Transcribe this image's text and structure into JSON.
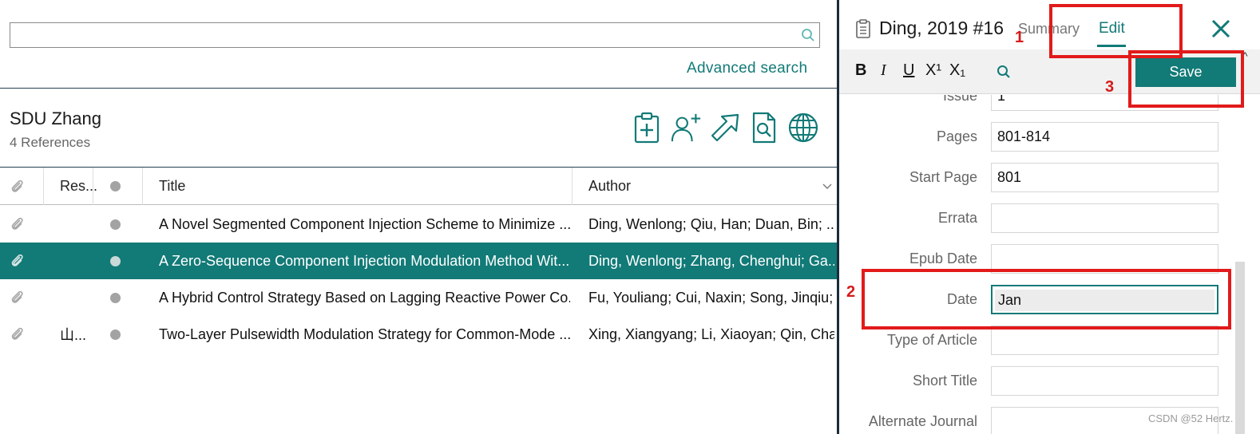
{
  "search": {
    "value": "",
    "placeholder": ""
  },
  "advanced_search_label": "Advanced search",
  "group": {
    "title": "SDU Zhang",
    "count": "4 References"
  },
  "toolbar_icons": [
    "add-reference-icon",
    "add-user-icon",
    "export-arrow-icon",
    "find-pdf-icon",
    "online-search-globe-icon"
  ],
  "table": {
    "headers": {
      "attachment": "",
      "research": "Res...",
      "read": "",
      "title": "Title",
      "author": "Author"
    },
    "rows": [
      {
        "research": "",
        "title": "A Novel Segmented Component Injection Scheme to Minimize ...",
        "author": "Ding, Wenlong; Qiu, Han; Duan, Bin; ...",
        "selected": false
      },
      {
        "research": "",
        "title": "A Zero-Sequence Component Injection Modulation Method Wit...",
        "author": "Ding, Wenlong; Zhang, Chenghui; Ga...",
        "selected": true
      },
      {
        "research": "",
        "title": "A Hybrid Control Strategy Based on Lagging Reactive Power Co...",
        "author": "Fu, Youliang; Cui, Naxin; Song, Jinqiu; ...",
        "selected": false
      },
      {
        "research": "山...",
        "title": "Two-Layer Pulsewidth Modulation Strategy for Common-Mode ...",
        "author": "Xing, Xiangyang; Li, Xiaoyan; Qin, Cha...",
        "selected": false
      }
    ]
  },
  "detail": {
    "ref_title": "Ding, 2019 #16",
    "tab_summary": "Summary",
    "tab_edit": "Edit",
    "format_buttons": {
      "bold": "B",
      "italic": "I",
      "underline": "U",
      "superscript": "X¹",
      "subscript": "X₁"
    },
    "save_label": "Save",
    "fields": [
      {
        "label": "Issue",
        "value": "1"
      },
      {
        "label": "Pages",
        "value": "801-814"
      },
      {
        "label": "Start Page",
        "value": "801"
      },
      {
        "label": "Errata",
        "value": ""
      },
      {
        "label": "Epub Date",
        "value": ""
      },
      {
        "label": "Date",
        "value": "Jan"
      },
      {
        "label": "Type of Article",
        "value": ""
      },
      {
        "label": "Short Title",
        "value": ""
      },
      {
        "label": "Alternate Journal",
        "value": ""
      }
    ]
  },
  "annotations": {
    "n1": "1",
    "n2": "2",
    "n3": "3"
  },
  "watermark": "CSDN @52 Hertz.",
  "colors": {
    "accent": "#127a77",
    "annotation_red": "#e21a1a",
    "dark_bar": "#0d2236"
  }
}
